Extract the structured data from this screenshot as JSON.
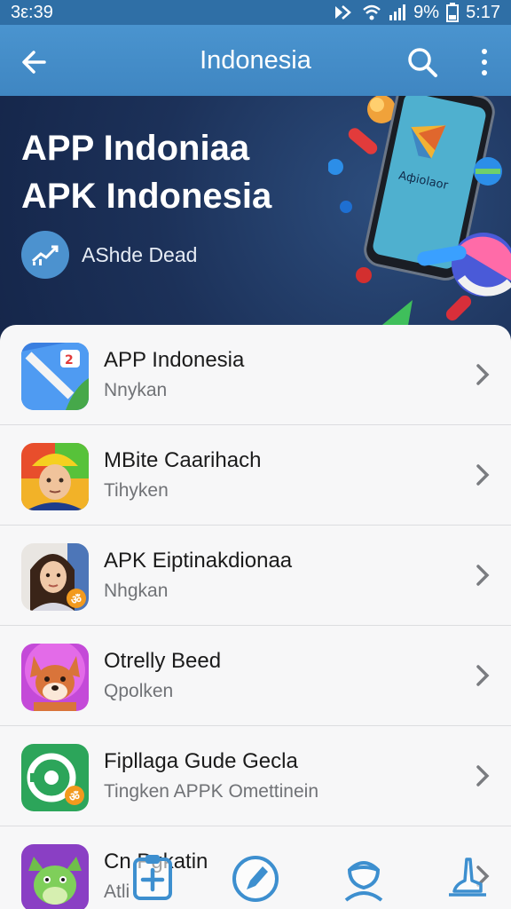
{
  "status_bar": {
    "time_left": "3ε:39",
    "battery_percent": "9%",
    "time_right": "5:17"
  },
  "app_bar": {
    "title": "Indonesia",
    "back_icon": "back-arrow-icon",
    "search_icon": "search-icon",
    "more_icon": "more-vert-icon"
  },
  "banner": {
    "title_line1": "APP Indoniaa",
    "title_line2": "APK Indonesia",
    "subtitle": "AShde Dead",
    "phone_label": "Aфiolaor"
  },
  "apps": [
    {
      "name": "APP Indonesia",
      "subtitle": "Nnykan"
    },
    {
      "name": "MBite Caarihach",
      "subtitle": "Tihyken"
    },
    {
      "name": "APK Eiptinakdionaa",
      "subtitle": "Nhgkan"
    },
    {
      "name": "Otrelly Beed",
      "subtitle": "Qpolken"
    },
    {
      "name": "Fipllaga Gude Gecla",
      "subtitle": "Tingken APPK Omettinein"
    },
    {
      "name": "Cn Pgkatin",
      "subtitle": "Atli"
    }
  ],
  "bottom_nav": [
    "add-icon",
    "edit-icon",
    "profile-icon",
    "hand-icon"
  ],
  "colors": {
    "status_bar": "#2f6fa6",
    "app_bar": "#4a94cf",
    "banner": "#1c3159",
    "accent": "#3d8fcf"
  }
}
